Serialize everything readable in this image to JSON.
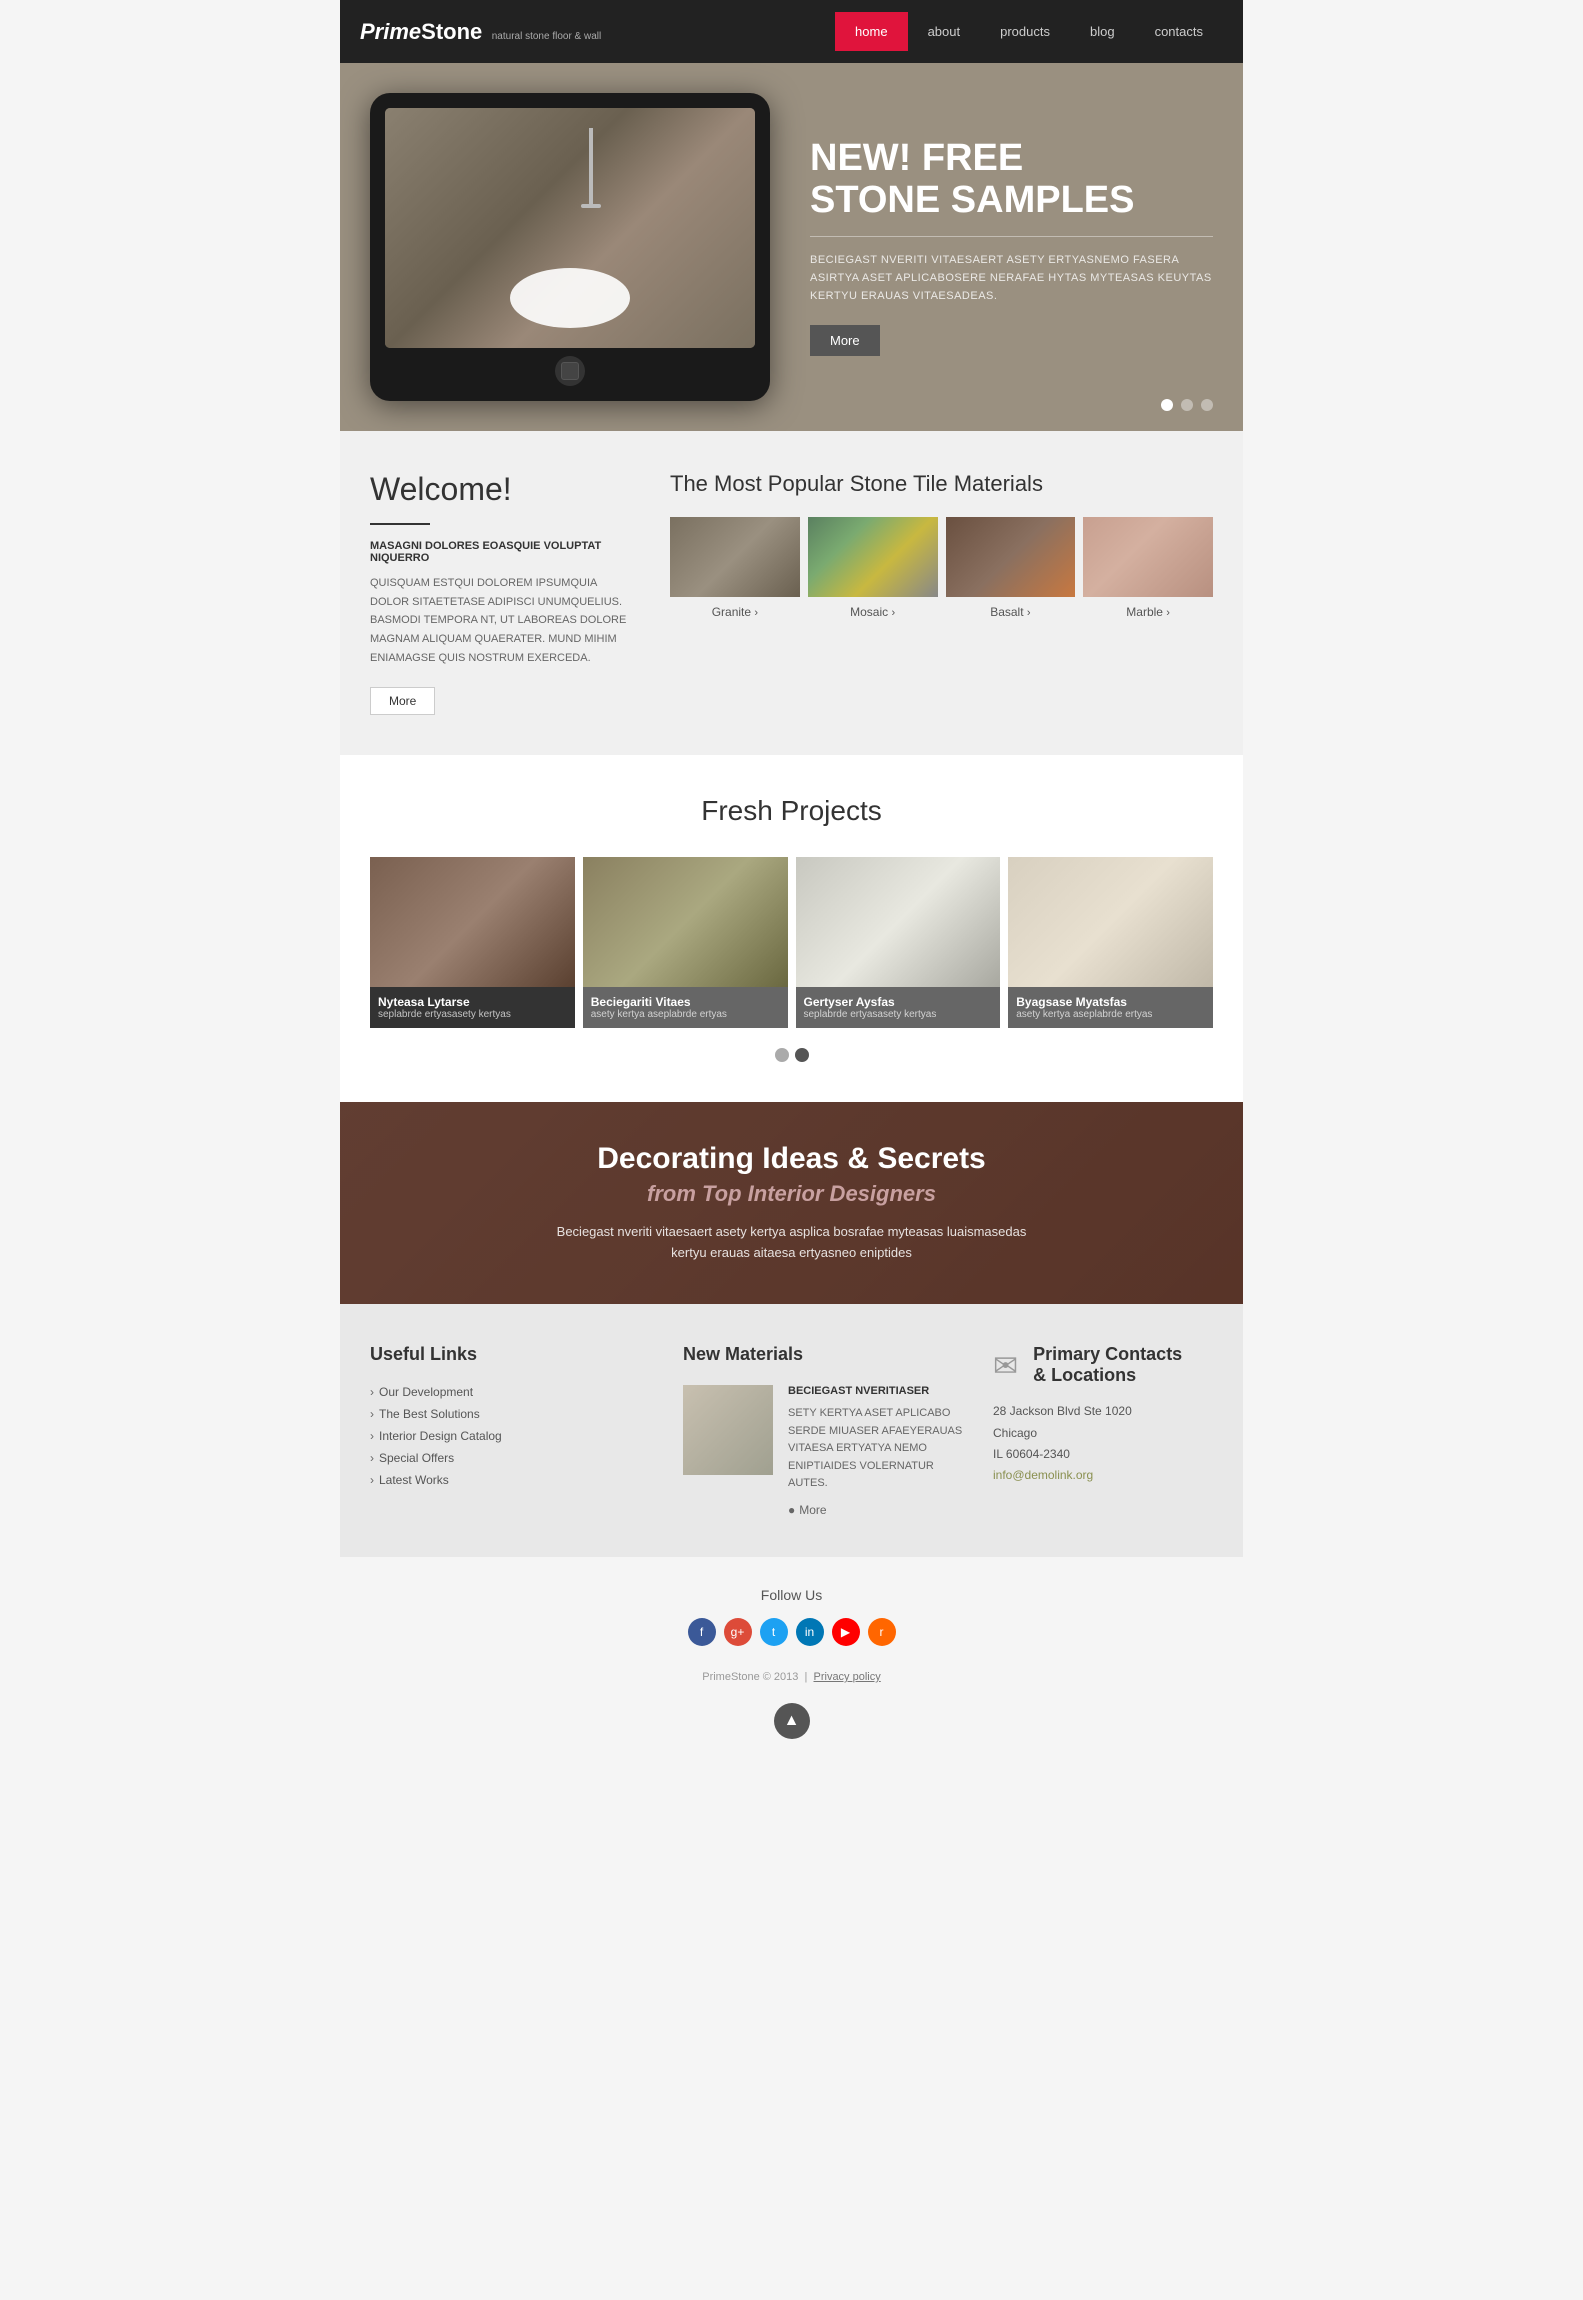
{
  "header": {
    "logo": "PrimeStone",
    "logo_subtitle": "natural stone floor & wall",
    "nav": [
      {
        "label": "home",
        "active": true
      },
      {
        "label": "about",
        "active": false
      },
      {
        "label": "products",
        "active": false
      },
      {
        "label": "blog",
        "active": false
      },
      {
        "label": "contacts",
        "active": false
      }
    ]
  },
  "hero": {
    "badge": "NEW! FREE",
    "title": "STONE SAMPLES",
    "description": "BECIEGAST NVERITI VITAESAERT ASETY ERTYASNEMO FASERA ASIRTYA ASET APLICABOSERE NERAFAE HYTAS MYTEASAS KEUYTAS KERTYU ERAUAS VITAESADEAS.",
    "button": "More",
    "dots": [
      {
        "active": true
      },
      {
        "active": false
      },
      {
        "active": false
      }
    ]
  },
  "welcome": {
    "title": "Welcome!",
    "subtitle": "MASAGNI DOLORES EOASQUIE VOLUPTAT NIQUERRO",
    "text": "QUISQUAM ESTQUI DOLOREM IPSUMQUIA DOLOR SITAETETASE ADIPISCI UNUMQUELIUS. BASMODI TEMPORA NT, UT LABOREAS DOLORE MAGNAM ALIQUAM QUAERATER. MUND MIHIM ENIAMAGSE QUIS NOSTRUM EXERCEDA.",
    "button": "More"
  },
  "materials": {
    "title": "The Most Popular Stone Tile Materials",
    "items": [
      {
        "name": "Granite",
        "type": "granite"
      },
      {
        "name": "Mosaic",
        "type": "mosaic"
      },
      {
        "name": "Basalt",
        "type": "basalt"
      },
      {
        "name": "Marble",
        "type": "marble"
      }
    ]
  },
  "projects": {
    "title": "Fresh Projects",
    "items": [
      {
        "name": "Nyteasa Lytarse",
        "desc": "seplabrde ertyasasety kertyas",
        "type": "proj1",
        "active_overlay": true
      },
      {
        "name": "Beciegariti Vitaes",
        "desc": "asety kertya aseplabrde ertyas",
        "type": "proj2",
        "active_overlay": false
      },
      {
        "name": "Gertyser Aysfas",
        "desc": "seplabrde ertyasasety kertyas",
        "type": "proj3",
        "active_overlay": false
      },
      {
        "name": "Byagsase Myatsfas",
        "desc": "asety kertya aseplabrde ertyas",
        "type": "proj4",
        "active_overlay": false
      }
    ]
  },
  "deco_banner": {
    "title": "Decorating Ideas & Secrets",
    "subtitle": "from Top Interior Designers",
    "desc": "Beciegast nveriti vitaesaert asety kertya asplica bosrafae myteasas luaismasedas kertyu erauas aitaesa ertyasneo eniptides"
  },
  "footer": {
    "useful_links": {
      "title": "Useful Links",
      "items": [
        {
          "label": "Our Development"
        },
        {
          "label": "The Best Solutions"
        },
        {
          "label": "Interior Design Catalog"
        },
        {
          "label": "Special Offers"
        },
        {
          "label": "Latest Works"
        }
      ]
    },
    "new_materials": {
      "title": "New Materials",
      "subtitle": "BECIEGAST NVERITIASER",
      "text": "SETY KERTYA ASET APLICABO SERDE MIUASER AFAEYERAUAS VITAESA ERTYATYA NEMO ENIPTIAIDES VOLERNATUR AUTES.",
      "more": "More"
    },
    "contacts": {
      "title": "Primary Contacts & Locations",
      "address": "28 Jackson Blvd Ste 1020\nChicago\nIL 60604-2340",
      "email": "info@demolink.org"
    },
    "follow_us": "Follow Us",
    "social": [
      {
        "label": "facebook",
        "class": "si-fb",
        "char": "f"
      },
      {
        "label": "google-plus",
        "class": "si-gp",
        "char": "g+"
      },
      {
        "label": "twitter",
        "class": "si-tw",
        "char": "t"
      },
      {
        "label": "linkedin",
        "class": "si-li",
        "char": "in"
      },
      {
        "label": "youtube",
        "class": "si-yt",
        "char": "▶"
      },
      {
        "label": "rss",
        "class": "si-rss",
        "char": "r"
      }
    ],
    "copyright": "PrimeStone © 2013",
    "privacy_policy": "Privacy policy"
  }
}
